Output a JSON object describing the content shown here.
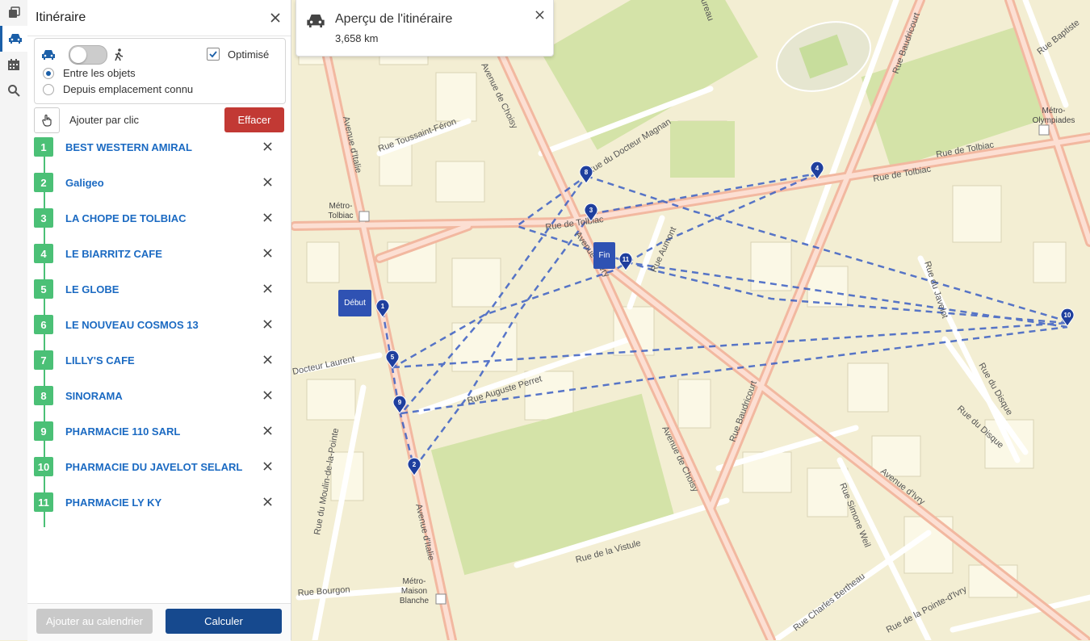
{
  "sidebar_title": "Itinéraire",
  "options": {
    "optimise_label": "Optimisé",
    "optimise_checked": true,
    "radio_between": "Entre les objets",
    "radio_from_known": "Depuis emplacement connu"
  },
  "add_by_click_label": "Ajouter par clic",
  "clear_label": "Effacer",
  "stops": [
    {
      "num": "1",
      "name": "BEST WESTERN AMIRAL"
    },
    {
      "num": "2",
      "name": "Galigeo"
    },
    {
      "num": "3",
      "name": "LA CHOPE DE TOLBIAC"
    },
    {
      "num": "4",
      "name": "LE BIARRITZ CAFE"
    },
    {
      "num": "5",
      "name": "LE GLOBE"
    },
    {
      "num": "6",
      "name": "LE NOUVEAU COSMOS 13"
    },
    {
      "num": "7",
      "name": "LILLY'S CAFE"
    },
    {
      "num": "8",
      "name": "SINORAMA"
    },
    {
      "num": "9",
      "name": "PHARMACIE 110 SARL"
    },
    {
      "num": "10",
      "name": "PHARMACIE DU JAVELOT SELARL"
    },
    {
      "num": "11",
      "name": "PHARMACIE LY KY"
    }
  ],
  "footer": {
    "calendar_label": "Ajouter au calendrier",
    "compute_label": "Calculer"
  },
  "summary": {
    "title": "Aperçu de l'itinéraire",
    "distance": "3,658 km"
  },
  "map": {
    "start_label": "Début",
    "end_label": "Fin",
    "markers": [
      "1",
      "2",
      "3",
      "4",
      "5",
      "8",
      "9",
      "10",
      "11"
    ],
    "street_labels": {
      "avenue_italie_top": "Avenue d'Italie",
      "avenue_italie_bottom": "Avenue d'Italie",
      "avenue_choisy_top": "Avenue de Choisy",
      "avenue_choisy_bottom": "Avenue de Choisy",
      "rue_tolbiac_east": "Rue de Tolbiac",
      "rue_tolbiac_east2": "Rue de Tolbiac",
      "rue_tolbiac_west": "Rue de Tolbiac",
      "rue_toussaint": "Rue Toussaint-Féron",
      "rue_magnan": "Rue du Docteur Magnan",
      "rue_baudricourt_top": "Rue Baudricourt",
      "rue_baudricourt_mid": "Rue Baudricourt",
      "rue_baptiste": "Rue Baptiste",
      "avenue_ivry_mid": "Avenue d'Ivry",
      "avenue_ivry_low": "Avenue d'Ivry",
      "rue_aumont": "Rue Aumont",
      "rue_javelot": "Rue du Javelot",
      "rue_laurent": "Docteur Laurent",
      "rue_perret": "Rue Auguste Perret",
      "rue_disque": "Rue du Disque",
      "rue_moulin": "Rue du Moulin-de-la-Pointe",
      "rue_weil": "Rue Simone Weil",
      "rue_vistule": "Rue de la Vistule",
      "rue_bourgon": "Rue Bourgon",
      "rue_bertheau": "Rue Charles Bertheau",
      "rue_pointe": "Rue de la Pointe-d'Ivry",
      "rue_nationale": "Rue du Disque",
      "rue_top_edge": "ureau"
    },
    "metro_labels": {
      "tolbiac": "Métro-Tolbiac",
      "olympiades_line1": "Métro-",
      "olympiades_line2": "Olympiades",
      "maison_line1": "Métro-",
      "maison_line2": "Maison",
      "maison_line3": "Blanche"
    }
  },
  "colors": {
    "stop_badge": "#4bc076",
    "stop_link": "#1b6ac2",
    "clear_button": "#c23934",
    "compute_button": "#16498e",
    "route_line": "#3b5fc4",
    "major_road": "#f2b8a0"
  },
  "icons": {
    "rail": [
      "layers-icon",
      "car-icon",
      "calendar-icon",
      "search-icon"
    ],
    "mode_car": "car-icon",
    "mode_walk": "walk-icon",
    "click": "hand-pointer-icon",
    "remove": "close-icon",
    "metro": "metro-icon"
  }
}
